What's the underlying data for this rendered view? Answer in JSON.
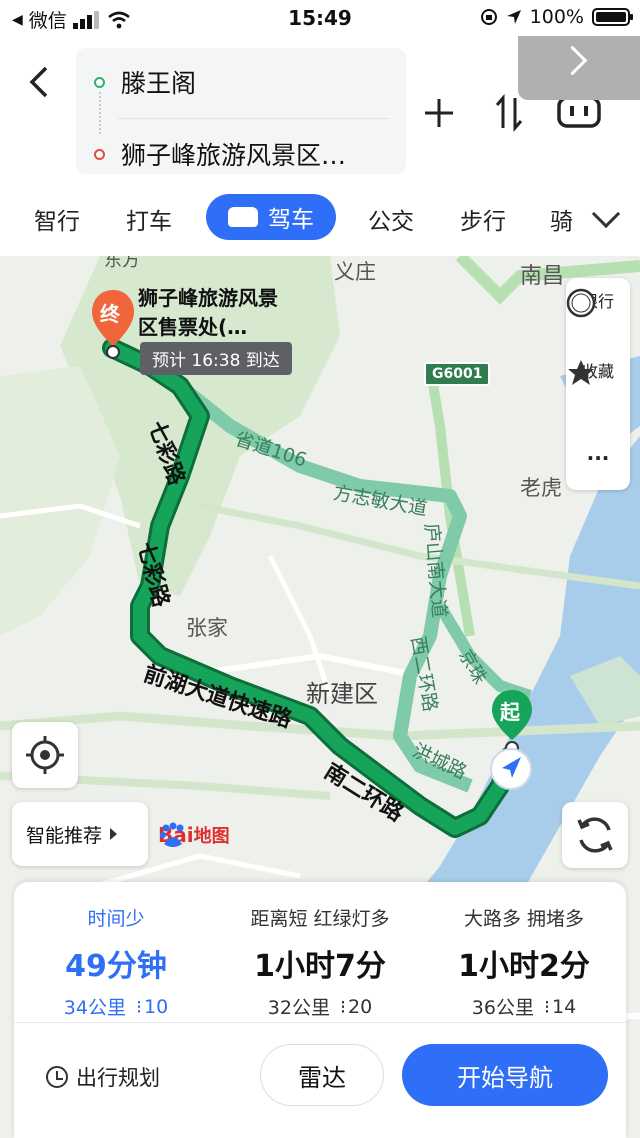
{
  "status_bar": {
    "carrier": "微信",
    "time": "15:49",
    "battery": "100%"
  },
  "route": {
    "start": "滕王阁",
    "end": "狮子峰旅游风景区…"
  },
  "modes": [
    {
      "label": "智行"
    },
    {
      "label": "打车"
    },
    {
      "label": "驾车",
      "active": true
    },
    {
      "label": "公交"
    },
    {
      "label": "步行"
    },
    {
      "label": "骑"
    }
  ],
  "map": {
    "destination_label": "狮子峰旅游风景区售票处(…",
    "destination_marker": "终",
    "start_marker": "起",
    "eta": "预计 16:38 到达",
    "highway_shield": "G6001",
    "place_labels": [
      "义庄",
      "南昌",
      "新建区",
      "张家",
      "老虎",
      "东方"
    ],
    "road_labels": [
      "七彩路",
      "七彩路",
      "前湖大道快速路",
      "南二环路",
      "省道106",
      "方志敏大道",
      "庐山南大道",
      "西二环路",
      "洪城路",
      "京珠"
    ],
    "side_panel": {
      "restrict": "限行",
      "restrict_badge": "限",
      "favorite": "收藏",
      "more": "···"
    },
    "smart_recommend": "智能推荐",
    "logo": "Bai地图",
    "colors": {
      "route": "#16a35a",
      "route_outline": "#0d6e3a",
      "alt_route": "#7fcaa8",
      "water": "#a8cdea",
      "road": "#ffffff",
      "highway": "#b7e0b2"
    }
  },
  "routes": [
    {
      "tag": "时间少",
      "time": "49分钟",
      "distance": "34公里",
      "lights": "10",
      "selected": true
    },
    {
      "tag": "距离短  红绿灯多",
      "time": "1小时7分",
      "distance": "32公里",
      "lights": "20"
    },
    {
      "tag": "大路多  拥堵多",
      "time": "1小时2分",
      "distance": "36公里",
      "lights": "14"
    }
  ],
  "actions": {
    "plan": "出行规划",
    "radar": "雷达",
    "navigate": "开始导航"
  }
}
